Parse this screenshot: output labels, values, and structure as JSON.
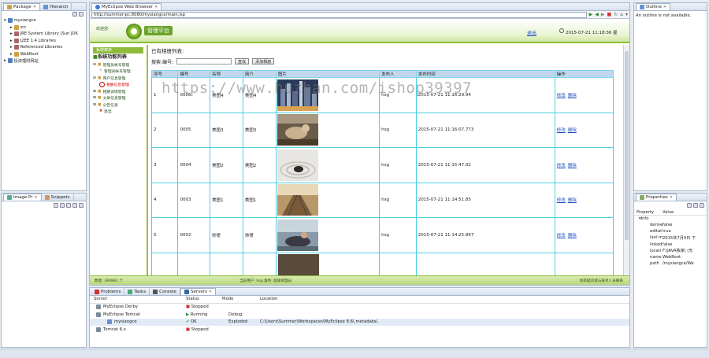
{
  "left_top": {
    "tabs": [
      "Package",
      "Hierarch"
    ],
    "tree": [
      "mysiangce",
      "src",
      "JRE System Library [Sun JDK",
      "J2EE 1.4 Libraries",
      "Referenced Libraries",
      "WebRoot",
      "投资理财网站"
    ]
  },
  "left_bottom": {
    "tabs": [
      "Image Pr",
      "Snippets"
    ]
  },
  "browser": {
    "tab": "MyEclipse Web Browser",
    "url": "http://summer-pc:8080/mysiangce/main.jsp"
  },
  "app": {
    "logo_small": "欢迎您·",
    "logo_title": "管理平台",
    "logout": "退出",
    "datetime": "2015-07-21 11:18:36",
    "weekday": "星",
    "footer_left": "数量: 390891 个",
    "footer_mid": "当前用户: hsg  角色: 超级管理员",
    "footer_right": "如有疑问请与技术人员联系"
  },
  "sidebar": {
    "header": "系统菜单",
    "title": "系统功能列表",
    "items": [
      "管理员帐号管理",
      "管理员帐号管理",
      "用户信息管理",
      "相册信息管理",
      "相册详情管理",
      "文章信息管理",
      "公告信息",
      "退出"
    ]
  },
  "main": {
    "page_title": "已有相册列表:",
    "search_label": "搜索:编号:",
    "search_btn": "查找",
    "add_btn": "添加相册",
    "columns": [
      "序号",
      "编号",
      "名称",
      "简介",
      "图片",
      "发布人",
      "发布时间",
      "操作"
    ],
    "rows": [
      {
        "idx": "1",
        "code": "0006",
        "name": "美图4",
        "intro": "美图4",
        "author": "hsg",
        "time": "2015-07-21 11:16:29.94",
        "img": "city"
      },
      {
        "idx": "2",
        "code": "0005",
        "name": "美图3",
        "intro": "美图3",
        "author": "hsg",
        "time": "2015-07-21 11:16:07.773",
        "img": "dog"
      },
      {
        "idx": "3",
        "code": "0004",
        "name": "美图2",
        "intro": "美图2",
        "author": "hsg",
        "time": "2015-07-21 11:15:47.02",
        "img": "stone"
      },
      {
        "idx": "4",
        "code": "0003",
        "name": "美图1",
        "intro": "美图1",
        "author": "hsg",
        "time": "2015-07-21 11:14:51.85",
        "img": "rail"
      },
      {
        "idx": "5",
        "code": "0002",
        "name": "帅哥",
        "intro": "帅哥",
        "author": "hsg",
        "time": "2015-07-21 11:14:25.867",
        "img": "man"
      }
    ],
    "edit_label": "修改",
    "delete_label": "删除"
  },
  "watermark": "https://www.huzhan.com/ishop39397",
  "outline": {
    "tab": "Outline",
    "message": "An outline is not available."
  },
  "properties": {
    "tab": "Properties",
    "headers": [
      "Property",
      "Value"
    ],
    "group": "Info",
    "rows": [
      [
        "derive",
        "false"
      ],
      [
        "editat",
        "true"
      ],
      [
        "last m",
        "2015年7月9日 下"
      ],
      [
        "linked",
        "false"
      ],
      [
        "locati",
        "F:\\JAVA独家\\ (无"
      ],
      [
        "name",
        "WebRoot"
      ],
      [
        "path",
        "/mysiangce/We"
      ]
    ]
  },
  "bottom": {
    "tabs": [
      "Problems",
      "Tasks",
      "Console",
      "Servers"
    ],
    "columns": [
      "Server",
      "Status",
      "Mode",
      "Location"
    ],
    "servers": [
      {
        "name": "MyEclipse Derby",
        "status": "Stopped",
        "mode": "",
        "loc": ""
      },
      {
        "name": "MyEclipse Tomcat",
        "status": "Running",
        "mode": "Debug",
        "loc": ""
      },
      {
        "name": "mysiangce",
        "status": "OK",
        "mode": "Exploded",
        "loc": "C:\\Users\\Summer\\Workspaces\\MyEclipse 8.6\\.metadata\\."
      },
      {
        "name": "Tomcat 6.x",
        "status": "Stopped",
        "mode": "",
        "loc": ""
      }
    ]
  }
}
